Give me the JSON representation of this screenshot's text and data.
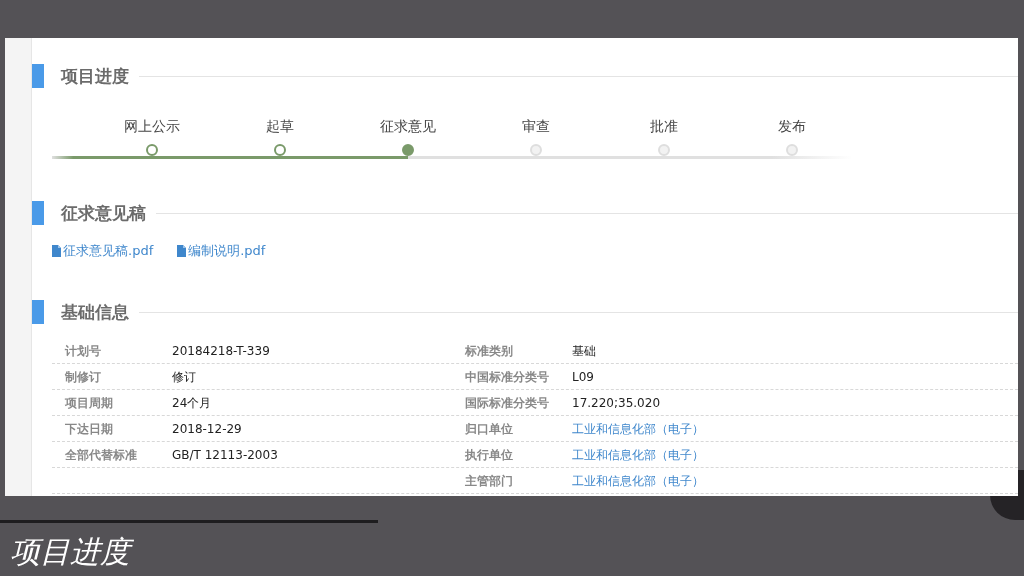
{
  "sections": [
    {
      "kind": "progress",
      "title": "项目进度",
      "steps": [
        {
          "label": "网上公示",
          "reached": true,
          "selected": false
        },
        {
          "label": "起草",
          "reached": true,
          "selected": false
        },
        {
          "label": "征求意见",
          "reached": true,
          "selected": true
        },
        {
          "label": "审查",
          "reached": false,
          "selected": false
        },
        {
          "label": "批准",
          "reached": false,
          "selected": false
        },
        {
          "label": "发布",
          "reached": false,
          "selected": false
        }
      ]
    },
    {
      "kind": "files",
      "title": "征求意见稿",
      "files": [
        "征求意见稿.pdf",
        "编制说明.pdf"
      ]
    },
    {
      "kind": "info",
      "title": "基础信息",
      "rows": [
        {
          "left": {
            "label": "计划号",
            "value": "20184218-T-339",
            "link": false
          },
          "right": {
            "label": "标准类别",
            "value": "基础",
            "link": false
          }
        },
        {
          "left": {
            "label": "制修订",
            "value": "修订",
            "link": false
          },
          "right": {
            "label": "中国标准分类号",
            "value": "L09",
            "link": false
          }
        },
        {
          "left": {
            "label": "项目周期",
            "value": "24个月",
            "link": false
          },
          "right": {
            "label": "国际标准分类号",
            "value": "17.220;35.020",
            "link": false
          }
        },
        {
          "left": {
            "label": "下达日期",
            "value": "2018-12-29",
            "link": false
          },
          "right": {
            "label": "归口单位",
            "value": "工业和信息化部（电子）",
            "link": true
          }
        },
        {
          "left": {
            "label": "全部代替标准",
            "value": "GB/T 12113-2003",
            "link": false
          },
          "right": {
            "label": "执行单位",
            "value": "工业和信息化部（电子）",
            "link": true
          }
        },
        {
          "right": {
            "label": "主管部门",
            "value": "工业和信息化部（电子）",
            "link": true
          }
        }
      ]
    }
  ],
  "caption": "项目进度"
}
